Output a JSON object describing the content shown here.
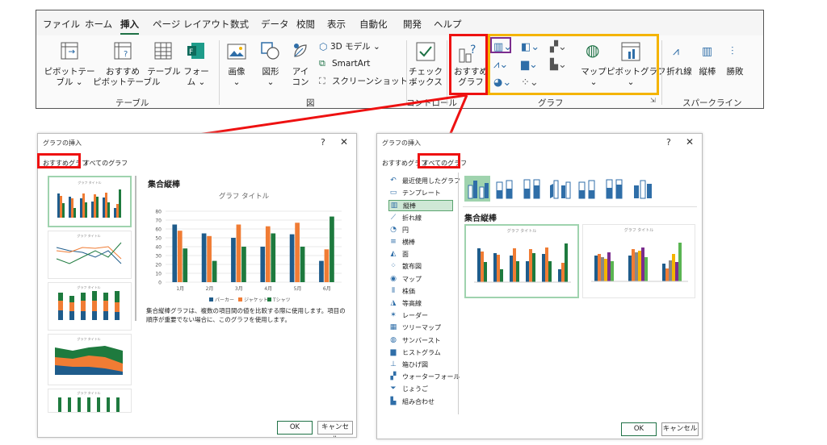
{
  "ribbon": {
    "tabs": [
      "ファイル",
      "ホーム",
      "挿入",
      "ページ レイアウト",
      "数式",
      "データ",
      "校閲",
      "表示",
      "自動化",
      "開発",
      "ヘルプ"
    ],
    "active_tab": "挿入",
    "pivot_table_line1": "ピボットテー",
    "pivot_table_line2": "ブル ⌄",
    "recommended_pivot_line1": "おすすめ",
    "recommended_pivot_line2": "ピボットテーブル",
    "table_label": "テーブル",
    "forms_line1": "フォー",
    "forms_line2": "ム ⌄",
    "group_tables": "テーブル",
    "image_line1": "画像",
    "image_line2": "⌄",
    "shapes_line1": "図形",
    "shapes_line2": "⌄",
    "icons_line1": "アイ",
    "icons_line2": "コン",
    "models_3d": "3D モデル  ⌄",
    "smartart": "SmartArt",
    "screenshot": "スクリーンショット ⌄",
    "group_illustrations": "図",
    "checkbox_line1": "チェック",
    "checkbox_line2": "ボックス",
    "group_controls": "コントロール",
    "recommended_chart_line1": "おすすめ",
    "recommended_chart_line2": "グラフ",
    "maps_line1": "マップ",
    "maps_line2": "⌄",
    "pivot_chart_line1": "ピボットグラフ",
    "pivot_chart_line2": "⌄",
    "group_charts": "グラフ",
    "sparkline_line": "折れ線",
    "sparkline_column": "縦棒",
    "sparkline_winloss": "勝敗",
    "group_sparklines": "スパークライン"
  },
  "dialog_left": {
    "title": "グラフの挿入",
    "help": "?",
    "close": "✕",
    "tab_recommended": "おすすめグラフ",
    "tab_all": "すべてのグラフ",
    "preview_title": "集合縦棒",
    "chart_title": "グラフ タイトル",
    "description": "集合縦棒グラフは、複数の項目間の値を比較する際に使用します。項目の順序が重要でない場合に、このグラフを使用します。",
    "ok": "OK",
    "cancel": "キャンセル"
  },
  "dialog_right": {
    "title": "グラフの挿入",
    "help": "?",
    "close": "✕",
    "tab_recommended": "おすすめグラフ",
    "tab_all": "すべてのグラフ",
    "chart_types": [
      "最近使用したグラフ",
      "テンプレート",
      "縦棒",
      "折れ線",
      "円",
      "横棒",
      "面",
      "散布図",
      "マップ",
      "株価",
      "等高線",
      "レーダー",
      "ツリーマップ",
      "サンバースト",
      "ヒストグラム",
      "箱ひげ図",
      "ウォーターフォール",
      "じょうご",
      "組み合わせ"
    ],
    "chart_type_icons": [
      "↶",
      "▭",
      "▥",
      "⟋",
      "◔",
      "≡",
      "◭",
      "⁘",
      "◉",
      "⫴",
      "◮",
      "✶",
      "▦",
      "◍",
      "▆",
      "⊥",
      "▞",
      "⏷",
      "▙"
    ],
    "selected_type": "縦棒",
    "subtype_title": "集合縦棒",
    "thumb_title_1": "グラフ タイトル",
    "thumb_title_2": "グラフ タイトル",
    "ok": "OK",
    "cancel": "キャンセル"
  },
  "chart_data": {
    "type": "bar",
    "title": "グラフ タイトル",
    "categories": [
      "1月",
      "2月",
      "3月",
      "4月",
      "5月",
      "6月"
    ],
    "ylim": [
      0,
      80
    ],
    "yticks": [
      0,
      10,
      20,
      30,
      40,
      50,
      60,
      70,
      80
    ],
    "series": [
      {
        "name": "パーカー",
        "color": "#1f5c8b",
        "values": [
          65,
          55,
          50,
          40,
          54,
          24
        ]
      },
      {
        "name": "ジャケット",
        "color": "#f07c34",
        "values": [
          58,
          52,
          65,
          63,
          67,
          37
        ]
      },
      {
        "name": "Tシャツ",
        "color": "#1e7a3e",
        "values": [
          38,
          24,
          40,
          55,
          40,
          74
        ]
      }
    ],
    "legend": "bottom",
    "grid": true
  },
  "colors": {
    "red": "#e11111",
    "orange": "#f4b400",
    "purple": "#7b2d8e",
    "excel_green": "#1e7145",
    "selection_green": "#9fd3ae"
  }
}
